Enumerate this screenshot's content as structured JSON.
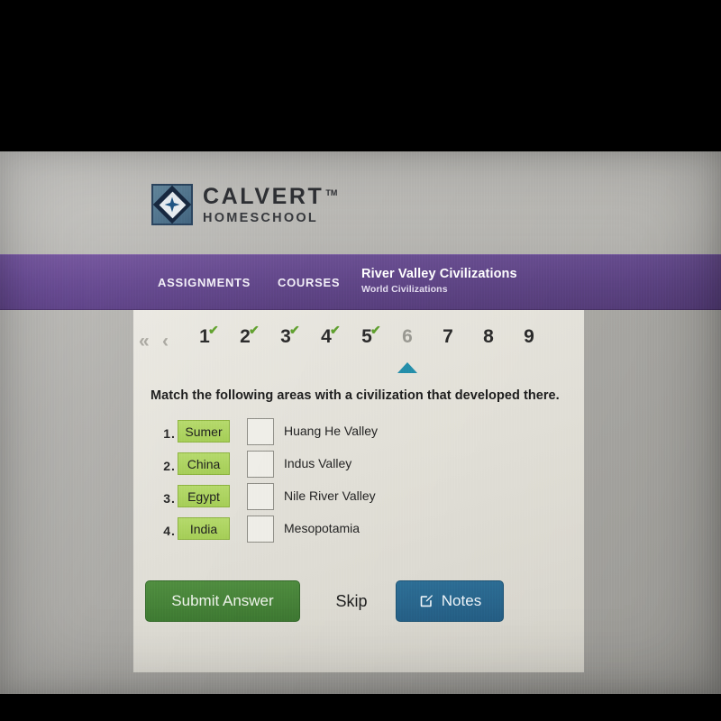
{
  "brand": {
    "name": "CALVERT",
    "tm": "TM",
    "subname": "HOMESCHOOL",
    "logo_icon": "diamond-star-icon"
  },
  "nav": {
    "assignments": "ASSIGNMENTS",
    "courses": "COURSES",
    "course_title": "River Valley Civilizations",
    "course_subtitle": "World Civilizations",
    "bar_color": "#5f4586"
  },
  "pager": {
    "first_icon": "«",
    "prev_icon": "‹",
    "check_glyph": "✔",
    "current": "6",
    "pages": [
      {
        "label": "1",
        "completed": true,
        "current": false
      },
      {
        "label": "2",
        "completed": true,
        "current": false
      },
      {
        "label": "3",
        "completed": true,
        "current": false
      },
      {
        "label": "4",
        "completed": true,
        "current": false
      },
      {
        "label": "5",
        "completed": true,
        "current": false
      },
      {
        "label": "6",
        "completed": false,
        "current": true
      },
      {
        "label": "7",
        "completed": false,
        "current": false
      },
      {
        "label": "8",
        "completed": false,
        "current": false
      },
      {
        "label": "9",
        "completed": false,
        "current": false
      }
    ],
    "caret_color": "#2490ab",
    "check_color": "#5f9f2e"
  },
  "question": {
    "prompt": "Match the following areas with a civilization that developed there."
  },
  "matching": {
    "tile_color": "#a4cd56",
    "rows": [
      {
        "num": "1",
        "dot": ".",
        "tile": "Sumer",
        "dropbox_value": "",
        "target": "Huang He Valley"
      },
      {
        "num": "2",
        "dot": ".",
        "tile": "China",
        "dropbox_value": "",
        "target": "Indus Valley"
      },
      {
        "num": "3",
        "dot": ".",
        "tile": "Egypt",
        "dropbox_value": "",
        "target": "Nile River Valley"
      },
      {
        "num": "4",
        "dot": ".",
        "tile": "India",
        "dropbox_value": "",
        "target": "Mesopotamia"
      }
    ]
  },
  "actions": {
    "submit": "Submit Answer",
    "skip": "Skip",
    "notes": "Notes",
    "notes_icon": "edit-square-pencil-icon",
    "submit_color": "#3f7a33",
    "notes_color": "#27638a"
  }
}
